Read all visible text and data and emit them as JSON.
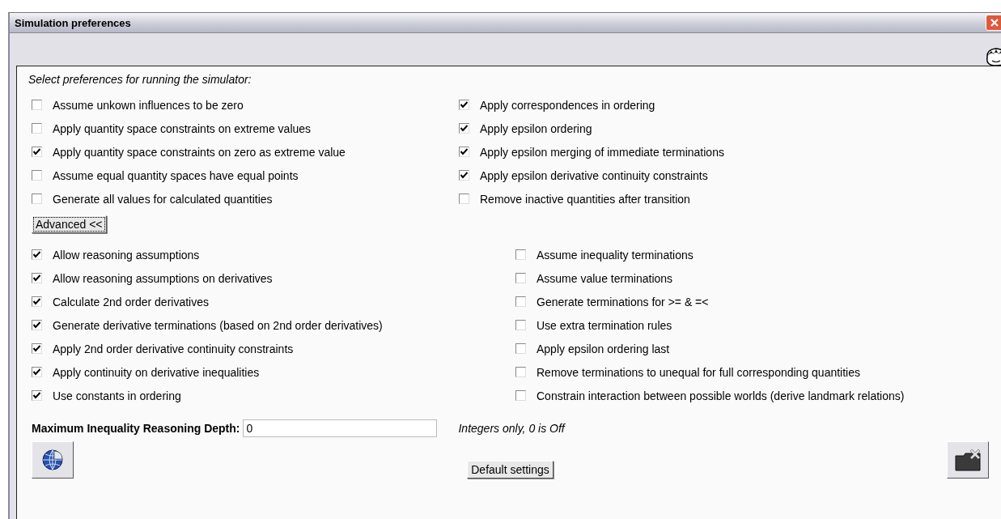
{
  "window": {
    "title": "Simulation preferences"
  },
  "intro": "Select preferences for running the simulator:",
  "basic_left": [
    {
      "label": "Assume unkown influences to be zero",
      "checked": false
    },
    {
      "label": "Apply quantity space constraints on extreme values",
      "checked": false
    },
    {
      "label": "Apply quantity space constraints on zero as extreme value",
      "checked": true
    },
    {
      "label": "Assume equal quantity spaces have equal points",
      "checked": false
    },
    {
      "label": "Generate all values for calculated quantities",
      "checked": false
    }
  ],
  "basic_right": [
    {
      "label": "Apply correspondences in ordering",
      "checked": true
    },
    {
      "label": "Apply epsilon ordering",
      "checked": true
    },
    {
      "label": "Apply epsilon merging of immediate terminations",
      "checked": true
    },
    {
      "label": "Apply epsilon derivative continuity constraints",
      "checked": true
    },
    {
      "label": "Remove inactive quantities after transition",
      "checked": false
    }
  ],
  "advanced_button": "Advanced <<",
  "advanced_left": [
    {
      "label": "Allow reasoning assumptions",
      "checked": true
    },
    {
      "label": "Allow reasoning assumptions on derivatives",
      "checked": true
    },
    {
      "label": "Calculate 2nd order derivatives",
      "checked": true
    },
    {
      "label": "Generate derivative terminations (based on 2nd order derivatives)",
      "checked": true
    },
    {
      "label": "Apply 2nd order derivative continuity constraints",
      "checked": true
    },
    {
      "label": "Apply continuity on derivative inequalities",
      "checked": true
    },
    {
      "label": "Use constants in ordering",
      "checked": true
    }
  ],
  "advanced_right": [
    {
      "label": "Assume inequality terminations",
      "checked": false
    },
    {
      "label": "Assume value terminations",
      "checked": false
    },
    {
      "label": "Generate terminations for >= & =<",
      "checked": false
    },
    {
      "label": "Use extra termination rules",
      "checked": false
    },
    {
      "label": "Apply epsilon ordering last",
      "checked": false
    },
    {
      "label": "Remove terminations to unequal for full corresponding quantities",
      "checked": false
    },
    {
      "label": "Constrain interaction between possible worlds (derive landmark relations)",
      "checked": false
    }
  ],
  "depth": {
    "label": "Maximum Inequality Reasoning Depth:",
    "value": "0",
    "hint": "Integers only, 0 is Off"
  },
  "default_button": "Default settings"
}
